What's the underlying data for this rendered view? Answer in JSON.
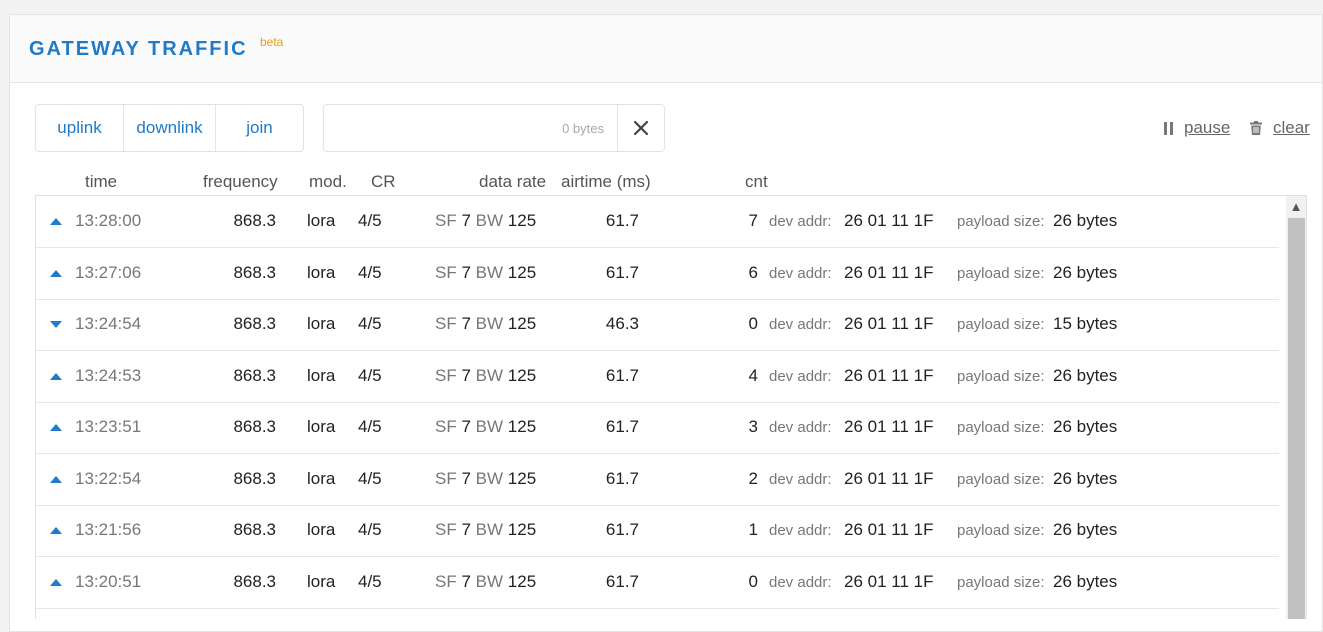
{
  "header": {
    "title": "GATEWAY TRAFFIC",
    "badge": "beta"
  },
  "filters": [
    {
      "label": "uplink"
    },
    {
      "label": "downlink"
    },
    {
      "label": "join"
    }
  ],
  "search": {
    "bytes_label": "0 bytes"
  },
  "actions": {
    "pause_label": "pause",
    "clear_label": "clear"
  },
  "columns": {
    "time": "time",
    "frequency": "frequency",
    "mod": "mod.",
    "cr": "CR",
    "data_rate": "data rate",
    "airtime": "airtime (ms)",
    "cnt": "cnt"
  },
  "labels": {
    "sf": "SF",
    "bw": "BW",
    "dev_addr": "dev addr:",
    "payload_size": "payload size:"
  },
  "rows": [
    {
      "dir": "up",
      "time": "13:28:00",
      "frequency": "868.3",
      "mod": "lora",
      "cr": "4/5",
      "sf": "7",
      "bw": "125",
      "airtime": "61.7",
      "cnt": "7",
      "dev_addr": "26 01 11 1F",
      "payload": "26 bytes"
    },
    {
      "dir": "up",
      "time": "13:27:06",
      "frequency": "868.3",
      "mod": "lora",
      "cr": "4/5",
      "sf": "7",
      "bw": "125",
      "airtime": "61.7",
      "cnt": "6",
      "dev_addr": "26 01 11 1F",
      "payload": "26 bytes"
    },
    {
      "dir": "down",
      "time": "13:24:54",
      "frequency": "868.3",
      "mod": "lora",
      "cr": "4/5",
      "sf": "7",
      "bw": "125",
      "airtime": "46.3",
      "cnt": "0",
      "dev_addr": "26 01 11 1F",
      "payload": "15 bytes"
    },
    {
      "dir": "up",
      "time": "13:24:53",
      "frequency": "868.3",
      "mod": "lora",
      "cr": "4/5",
      "sf": "7",
      "bw": "125",
      "airtime": "61.7",
      "cnt": "4",
      "dev_addr": "26 01 11 1F",
      "payload": "26 bytes"
    },
    {
      "dir": "up",
      "time": "13:23:51",
      "frequency": "868.3",
      "mod": "lora",
      "cr": "4/5",
      "sf": "7",
      "bw": "125",
      "airtime": "61.7",
      "cnt": "3",
      "dev_addr": "26 01 11 1F",
      "payload": "26 bytes"
    },
    {
      "dir": "up",
      "time": "13:22:54",
      "frequency": "868.3",
      "mod": "lora",
      "cr": "4/5",
      "sf": "7",
      "bw": "125",
      "airtime": "61.7",
      "cnt": "2",
      "dev_addr": "26 01 11 1F",
      "payload": "26 bytes"
    },
    {
      "dir": "up",
      "time": "13:21:56",
      "frequency": "868.3",
      "mod": "lora",
      "cr": "4/5",
      "sf": "7",
      "bw": "125",
      "airtime": "61.7",
      "cnt": "1",
      "dev_addr": "26 01 11 1F",
      "payload": "26 bytes"
    },
    {
      "dir": "up",
      "time": "13:20:51",
      "frequency": "868.3",
      "mod": "lora",
      "cr": "4/5",
      "sf": "7",
      "bw": "125",
      "airtime": "61.7",
      "cnt": "0",
      "dev_addr": "26 01 11 1F",
      "payload": "26 bytes"
    }
  ]
}
